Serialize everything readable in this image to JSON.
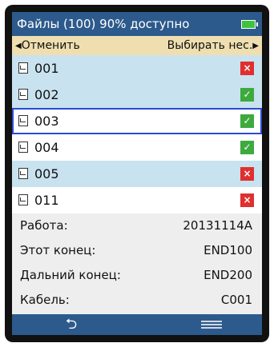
{
  "header": {
    "title": "Файлы (100) 90% доступно",
    "battery_color": "#41c23f"
  },
  "actions": {
    "cancel_label": "Отменить",
    "select_label": "Выбирать нес."
  },
  "files": [
    {
      "name": "001",
      "status": "err",
      "symbol": "×",
      "highlight": "blue"
    },
    {
      "name": "002",
      "status": "ok",
      "symbol": "✓",
      "highlight": "blue"
    },
    {
      "name": "003",
      "status": "ok",
      "symbol": "✓",
      "highlight": "selected"
    },
    {
      "name": "004",
      "status": "ok",
      "symbol": "✓",
      "highlight": "white"
    },
    {
      "name": "005",
      "status": "err",
      "symbol": "×",
      "highlight": "blue"
    },
    {
      "name": "011",
      "status": "err",
      "symbol": "×",
      "highlight": "white"
    }
  ],
  "details": [
    {
      "label": "Работа:",
      "value": "20131114A"
    },
    {
      "label": "Этот конец:",
      "value": "END100"
    },
    {
      "label": "Дальний конец:",
      "value": "END200"
    },
    {
      "label": "Кабель:",
      "value": "C001"
    }
  ],
  "footer": {
    "back_icon": "back-arrow-icon",
    "menu_icon": "menu-icon"
  },
  "colors": {
    "title_bg": "#2d5a8c",
    "action_bg": "#efdfb0",
    "row_blue": "#c9e2ef",
    "ok": "#3daa3d",
    "err": "#e02f2f",
    "selection_border": "#2a4bd1"
  }
}
